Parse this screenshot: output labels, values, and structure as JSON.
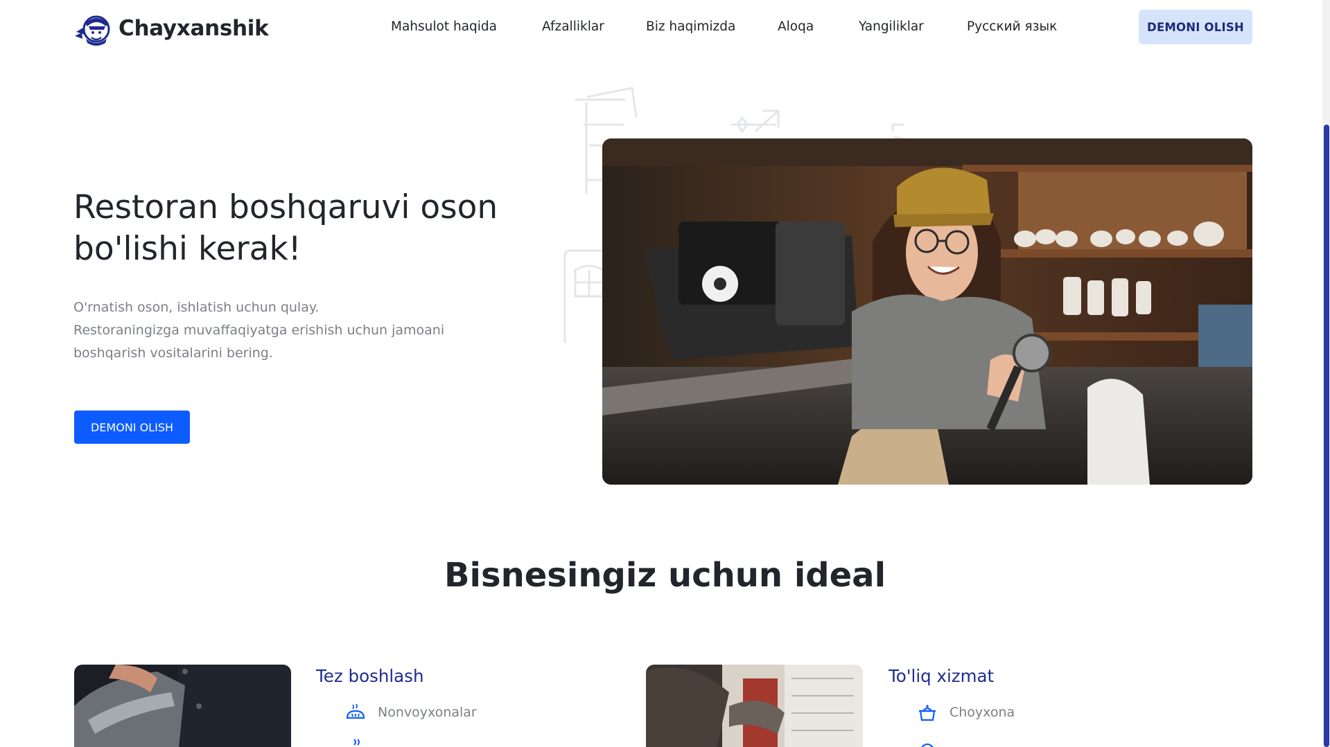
{
  "brand": {
    "name": "Chayxanshik",
    "accent": "#0d5cff",
    "navy": "#1f2c8f",
    "light_button": "#d6e4fb"
  },
  "header": {
    "nav": [
      {
        "label": "Mahsulot haqida"
      },
      {
        "label": "Afzalliklar"
      },
      {
        "label": "Biz haqimizda"
      },
      {
        "label": "Aloqa"
      },
      {
        "label": "Yangiliklar"
      },
      {
        "label": "Русский язык"
      }
    ],
    "cta_label": "DEMONI OLISH"
  },
  "hero": {
    "title_line1": "Restoran boshqaruvi oson",
    "title_line2": "bo'lishi kerak!",
    "desc_line1": "O'rnatish oson, ishlatish uchun qulay.",
    "desc_line2": "Restoraningizga muvaffaqiyatga erishish uchun jamoani",
    "desc_line3": "boshqarish vositalarini bering.",
    "cta_label": "DEMONI OLISH"
  },
  "section": {
    "title": "Bisnesingiz uchun ideal",
    "cards": [
      {
        "title": "Tez boshlash",
        "items": [
          {
            "label": "Nonvoyxonalar",
            "icon": "bread-icon"
          }
        ]
      },
      {
        "title": "To'liq xizmat",
        "items": [
          {
            "label": "Choyxona",
            "icon": "teapot-icon"
          }
        ]
      }
    ]
  }
}
